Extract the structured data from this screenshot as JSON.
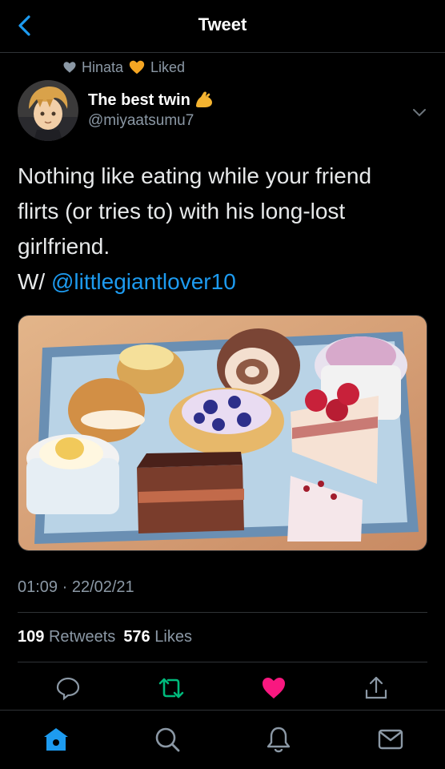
{
  "header": {
    "title": "Tweet"
  },
  "context": {
    "user": "Hinata",
    "action": "Liked"
  },
  "author": {
    "name": "The best twin",
    "handle": "@miyaatsumu7"
  },
  "tweet": {
    "lines": [
      "Nothing like eating while your friend",
      "flirts (or tries to) with his long-lost",
      "girlfriend."
    ],
    "prefix": "W/ ",
    "mention": "@littlegiantlover10"
  },
  "meta": {
    "timestamp": "01:09 · 22/02/21"
  },
  "stats": {
    "retweets_count": "109",
    "retweets_label": "Retweets",
    "likes_count": "576",
    "likes_label": "Likes"
  },
  "colors": {
    "accent": "#1d9bf0",
    "like": "#f91880",
    "retweet": "#00ba7c",
    "orange_heart": "#f5a623"
  },
  "icons": {
    "back": "chevron-left-icon",
    "caret": "chevron-down-icon",
    "reply": "reply-icon",
    "retweet": "retweet-icon",
    "like": "heart-filled-icon",
    "share": "share-icon",
    "home": "home-icon",
    "search": "search-icon",
    "notifications": "bell-icon",
    "messages": "mail-icon"
  }
}
